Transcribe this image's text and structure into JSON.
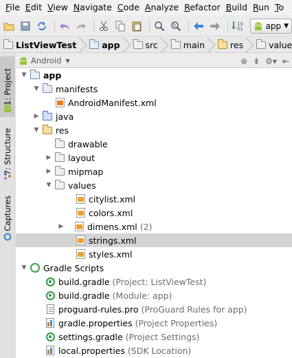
{
  "menu": [
    "File",
    "Edit",
    "View",
    "Navigate",
    "Code",
    "Analyze",
    "Refactor",
    "Build",
    "Run",
    "To"
  ],
  "toolbar": {
    "icons": [
      "open-icon",
      "save-icon",
      "sync-icon",
      "undo-icon",
      "redo-icon",
      "cut-icon",
      "copy-icon",
      "paste-icon",
      "find-icon",
      "replace-icon",
      "back-icon",
      "forward-icon",
      "make-project-icon"
    ],
    "run_config": "app"
  },
  "breadcrumb": [
    "ListViewTest",
    "app",
    "src",
    "main",
    "res",
    "values",
    ""
  ],
  "side_tabs": {
    "project": "1: Project",
    "structure": "7: Structure",
    "captures": "Captures"
  },
  "panel": {
    "view_selector": "Android"
  },
  "tree": [
    {
      "label": "app",
      "hint": "",
      "icon": "module-folder-icon",
      "expanded": true
    },
    {
      "label": "manifests",
      "hint": "",
      "icon": "folder-icon",
      "expanded": true
    },
    {
      "label": "AndroidManifest.xml",
      "hint": "",
      "icon": "manifest-file-icon"
    },
    {
      "label": "java",
      "hint": "",
      "icon": "source-folder-icon",
      "expanded": false
    },
    {
      "label": "res",
      "hint": "",
      "icon": "resource-folder-icon",
      "expanded": true
    },
    {
      "label": "drawable",
      "hint": "",
      "icon": "folder-icon"
    },
    {
      "label": "layout",
      "hint": "",
      "icon": "folder-icon",
      "expanded": false
    },
    {
      "label": "mipmap",
      "hint": "",
      "icon": "folder-icon",
      "expanded": false
    },
    {
      "label": "values",
      "hint": "",
      "icon": "folder-icon",
      "expanded": true
    },
    {
      "label": "citylist.xml",
      "hint": "",
      "icon": "xml-values-icon"
    },
    {
      "label": "colors.xml",
      "hint": "",
      "icon": "xml-values-icon"
    },
    {
      "label": "dimens.xml",
      "hint": "(2)",
      "icon": "xml-values-icon",
      "expanded": false
    },
    {
      "label": "strings.xml",
      "hint": "",
      "icon": "xml-values-icon",
      "selected": true
    },
    {
      "label": "styles.xml",
      "hint": "",
      "icon": "xml-values-icon"
    },
    {
      "label": "Gradle Scripts",
      "hint": "",
      "icon": "gradle-scripts-icon",
      "expanded": true
    },
    {
      "label": "build.gradle",
      "hint": "(Project: ListViewTest)",
      "icon": "gradle-file-icon"
    },
    {
      "label": "build.gradle",
      "hint": "(Module: app)",
      "icon": "gradle-file-icon"
    },
    {
      "label": "proguard-rules.pro",
      "hint": "(ProGuard Rules for app)",
      "icon": "text-file-icon"
    },
    {
      "label": "gradle.properties",
      "hint": "(Project Properties)",
      "icon": "properties-file-icon"
    },
    {
      "label": "settings.gradle",
      "hint": "(Project Settings)",
      "icon": "gradle-file-icon"
    },
    {
      "label": "local.properties",
      "hint": "(SDK Location)",
      "icon": "properties-file-icon"
    }
  ],
  "colors": {
    "selection": "#d4d4d4",
    "hint_text": "#6c6c6c",
    "android_green": "#9ac23c"
  }
}
